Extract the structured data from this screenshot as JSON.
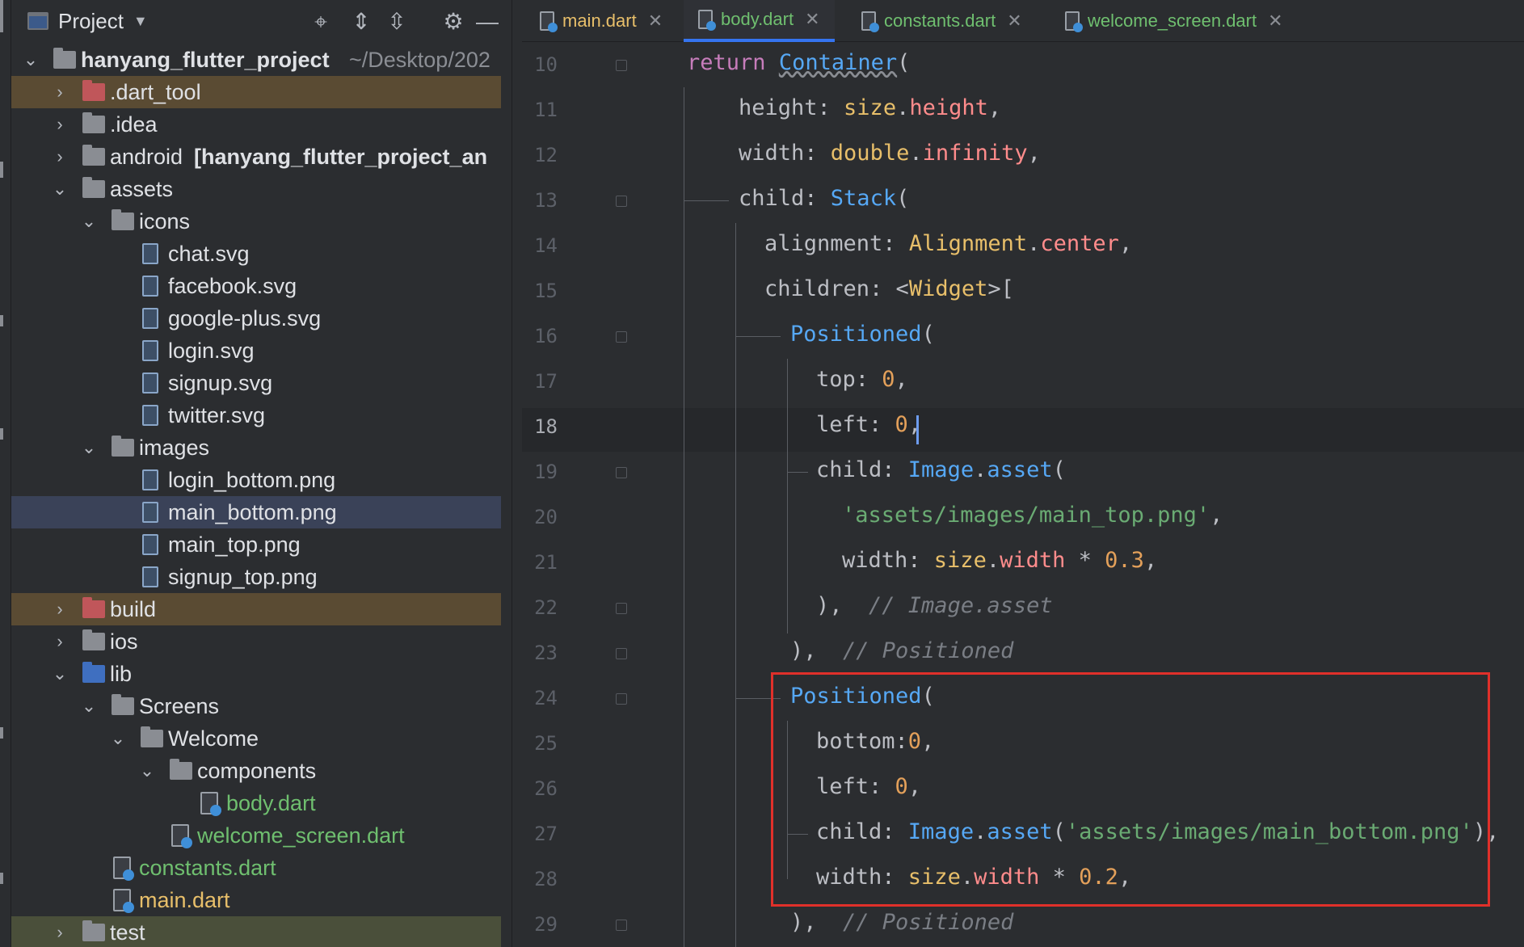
{
  "project_panel": {
    "title": "Project",
    "root": {
      "name": "hanyang_flutter_project",
      "path": "~/Desktop/202"
    },
    "items": [
      {
        "label": ".dart_tool"
      },
      {
        "label": ".idea"
      },
      {
        "label": "android",
        "suffix": "[hanyang_flutter_project_an"
      },
      {
        "label": "assets"
      },
      {
        "label": "icons"
      },
      {
        "label": "chat.svg"
      },
      {
        "label": "facebook.svg"
      },
      {
        "label": "google-plus.svg"
      },
      {
        "label": "login.svg"
      },
      {
        "label": "signup.svg"
      },
      {
        "label": "twitter.svg"
      },
      {
        "label": "images"
      },
      {
        "label": "login_bottom.png"
      },
      {
        "label": "main_bottom.png"
      },
      {
        "label": "main_top.png"
      },
      {
        "label": "signup_top.png"
      },
      {
        "label": "build"
      },
      {
        "label": "ios"
      },
      {
        "label": "lib"
      },
      {
        "label": "Screens"
      },
      {
        "label": "Welcome"
      },
      {
        "label": "components"
      },
      {
        "label": "body.dart"
      },
      {
        "label": "welcome_screen.dart"
      },
      {
        "label": "constants.dart"
      },
      {
        "label": "main.dart"
      },
      {
        "label": "test"
      }
    ]
  },
  "tabs": [
    {
      "label": "main.dart"
    },
    {
      "label": "body.dart",
      "active": true
    },
    {
      "label": "constants.dart"
    },
    {
      "label": "welcome_screen.dart"
    }
  ],
  "editor": {
    "current_line": 18,
    "line_numbers": [
      "10",
      "11",
      "12",
      "13",
      "14",
      "15",
      "16",
      "17",
      "18",
      "19",
      "20",
      "21",
      "22",
      "23",
      "24",
      "25",
      "26",
      "27",
      "28",
      "29"
    ],
    "code": {
      "l10": {
        "kw": "return",
        "cls": "Container",
        "p": "("
      },
      "l11": {
        "a": "height: ",
        "b": "size",
        "c": ".",
        "d": "height",
        "e": ","
      },
      "l12": {
        "a": "width: ",
        "b": "double",
        "c": ".",
        "d": "infinity",
        "e": ","
      },
      "l13": {
        "a": "child: ",
        "b": "Stack",
        "c": "("
      },
      "l14": {
        "a": "alignment: ",
        "b": "Alignment",
        "c": ".",
        "d": "center",
        "e": ","
      },
      "l15": {
        "a": "children: <",
        "b": "Widget",
        "c": ">["
      },
      "l16": {
        "a": "Positioned",
        "b": "("
      },
      "l17": {
        "a": "top: ",
        "b": "0",
        "c": ","
      },
      "l18": {
        "a": "left: ",
        "b": "0",
        "c": ","
      },
      "l19": {
        "a": "child: ",
        "b": "Image",
        "c": ".",
        "d": "asset",
        "e": "("
      },
      "l20": {
        "a": "'assets/images/main_top.png'",
        "b": ","
      },
      "l21": {
        "a": "width: ",
        "b": "size",
        "c": ".",
        "d": "width",
        "e": " * ",
        "f": "0.3",
        "g": ","
      },
      "l22": {
        "a": "),  ",
        "b": "// Image.asset"
      },
      "l23": {
        "a": "),  ",
        "b": "// Positioned"
      },
      "l24": {
        "a": "Positioned",
        "b": "("
      },
      "l25": {
        "a": "bottom:",
        "b": "0",
        "c": ","
      },
      "l26": {
        "a": "left: ",
        "b": "0",
        "c": ","
      },
      "l27": {
        "a": "child: ",
        "b": "Image",
        "c": ".",
        "d": "asset",
        "e": "(",
        "f": "'assets/images/main_bottom.png'",
        "g": "),"
      },
      "l28": {
        "a": "width: ",
        "b": "size",
        "c": ".",
        "d": "width",
        "e": " * ",
        "f": "0.2",
        "g": ","
      },
      "l29": {
        "a": "),  ",
        "b": "// Positioned"
      }
    }
  },
  "colors": {
    "highlight_box": "#e0302a",
    "accent": "#3574f0",
    "excluded_folder_bg": "#5a4b33",
    "selected_row_bg": "#3a4258"
  },
  "icons": [
    "project-window-icon",
    "locate-icon",
    "expand-all-icon",
    "collapse-all-icon",
    "gear-icon",
    "hide-icon",
    "folder-icon",
    "svg-file-icon",
    "png-file-icon",
    "dart-file-icon",
    "close-icon"
  ]
}
